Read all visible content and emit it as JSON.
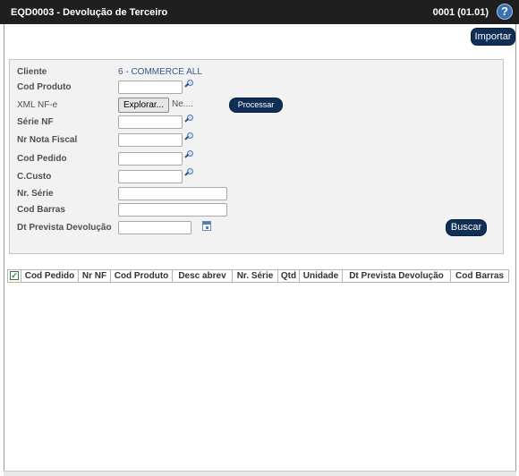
{
  "window": {
    "title": "EQD0003 - Devolução de Terceiro",
    "version": "0001 (01.01)",
    "help_label": "?"
  },
  "toolbar": {
    "import_label": "Importar"
  },
  "form": {
    "cliente_label": "Cliente",
    "cliente_value": "6 - COMMERCE ALL",
    "cod_produto_label": "Cod Produto",
    "xml_label": "XML NF-e",
    "file_button_label": "Explorar...",
    "file_name": "Ne....",
    "processar_label": "Processar",
    "serie_nf_label": "Série NF",
    "nr_nota_label": "Nr Nota Fiscal",
    "cod_pedido_label": "Cod Pedido",
    "ccusto_label": "C.Custo",
    "nr_serie_label": "Nr. Série",
    "cod_barras_label": "Cod Barras",
    "dt_prevista_label": "Dt Prevista Devolução",
    "buscar_label": "Buscar"
  },
  "grid": {
    "columns": [
      "Cod Pedido",
      "Nr NF",
      "Cod Produto",
      "Desc abrev",
      "Nr. Série",
      "Qtd",
      "Unidade",
      "Dt Prevista Devolução",
      "Cod Barras"
    ],
    "checkbox_mark": "✓"
  },
  "colors": {
    "titlebar": "#1f1f1f",
    "button": "#0f2f56",
    "panel": "#f2f2f2",
    "link_blue": "#365a86"
  },
  "icons": [
    "help-icon",
    "search-icon",
    "calendar-icon",
    "checkbox-icon"
  ]
}
